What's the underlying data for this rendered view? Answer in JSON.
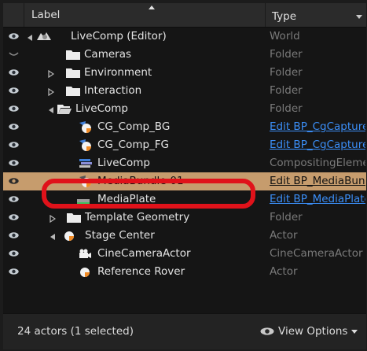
{
  "header": {
    "label": "Label",
    "type": "Type"
  },
  "rows": [
    {
      "name": "LiveComp (Editor)",
      "type": "World"
    },
    {
      "name": "Cameras",
      "type": "Folder"
    },
    {
      "name": "Environment",
      "type": "Folder"
    },
    {
      "name": "Interaction",
      "type": "Folder"
    },
    {
      "name": "LiveComp",
      "type": "Folder"
    },
    {
      "name": "CG_Comp_BG",
      "type": "Edit BP_CgCapture"
    },
    {
      "name": "CG_Comp_FG",
      "type": "Edit BP_CgCapture"
    },
    {
      "name": "LiveComp",
      "type": "CompositingElement"
    },
    {
      "name": "MediaBundle-01",
      "type": "Edit BP_MediaBundle"
    },
    {
      "name": "MediaPlate",
      "type": "Edit BP_MediaPlate"
    },
    {
      "name": "Template Geometry",
      "type": "Folder"
    },
    {
      "name": "Stage Center",
      "type": "Actor"
    },
    {
      "name": "CineCameraActor",
      "type": "CineCameraActor"
    },
    {
      "name": "Reference Rover",
      "type": "Actor"
    }
  ],
  "footer": {
    "count": "24 actors (1 selected)",
    "view_options": "View Options"
  },
  "colors": {
    "selection": "#c69c6d",
    "link": "#3b8ef7",
    "highlight_ring": "#e0121a"
  }
}
